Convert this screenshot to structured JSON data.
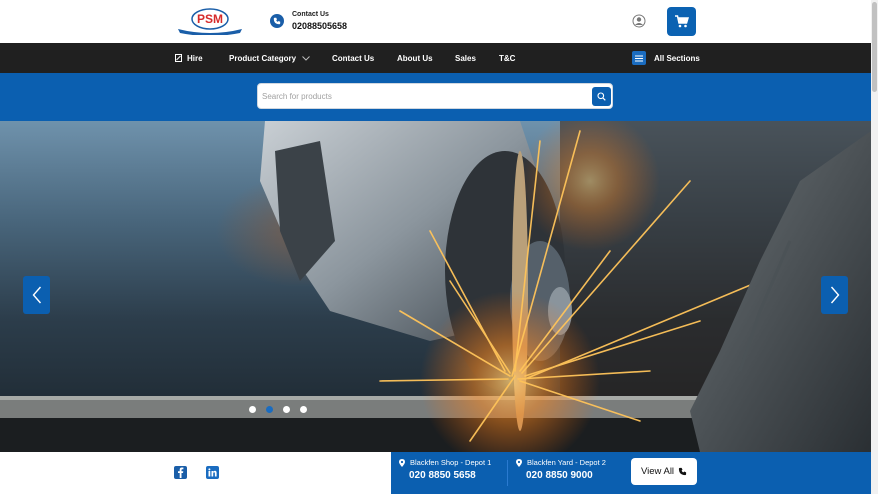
{
  "header": {
    "logo_text": "PSM",
    "contact_label": "Contact Us",
    "contact_phone": "02088505658"
  },
  "nav": {
    "items": [
      {
        "label": "Hire",
        "icon": "hire-icon"
      },
      {
        "label": "Product Category",
        "icon": "chevron-down-icon"
      },
      {
        "label": "Contact Us"
      },
      {
        "label": "About Us"
      },
      {
        "label": "Sales"
      },
      {
        "label": "T&C"
      }
    ],
    "all_sections": "All Sections"
  },
  "search": {
    "placeholder": "Search for products",
    "value": ""
  },
  "slider": {
    "dot_count": 4,
    "active_dot": 2
  },
  "footer": {
    "depots": [
      {
        "name": "Blackfen Shop - Depot 1",
        "phone": "020 8850 5658"
      },
      {
        "name": "Blackfen Yard - Depot 2",
        "phone": "020 8850 9000"
      }
    ],
    "view_all": "View All"
  },
  "colors": {
    "brand_blue": "#0b5fb0",
    "nav_dark": "#202020",
    "logo_red": "#d62b2b"
  }
}
